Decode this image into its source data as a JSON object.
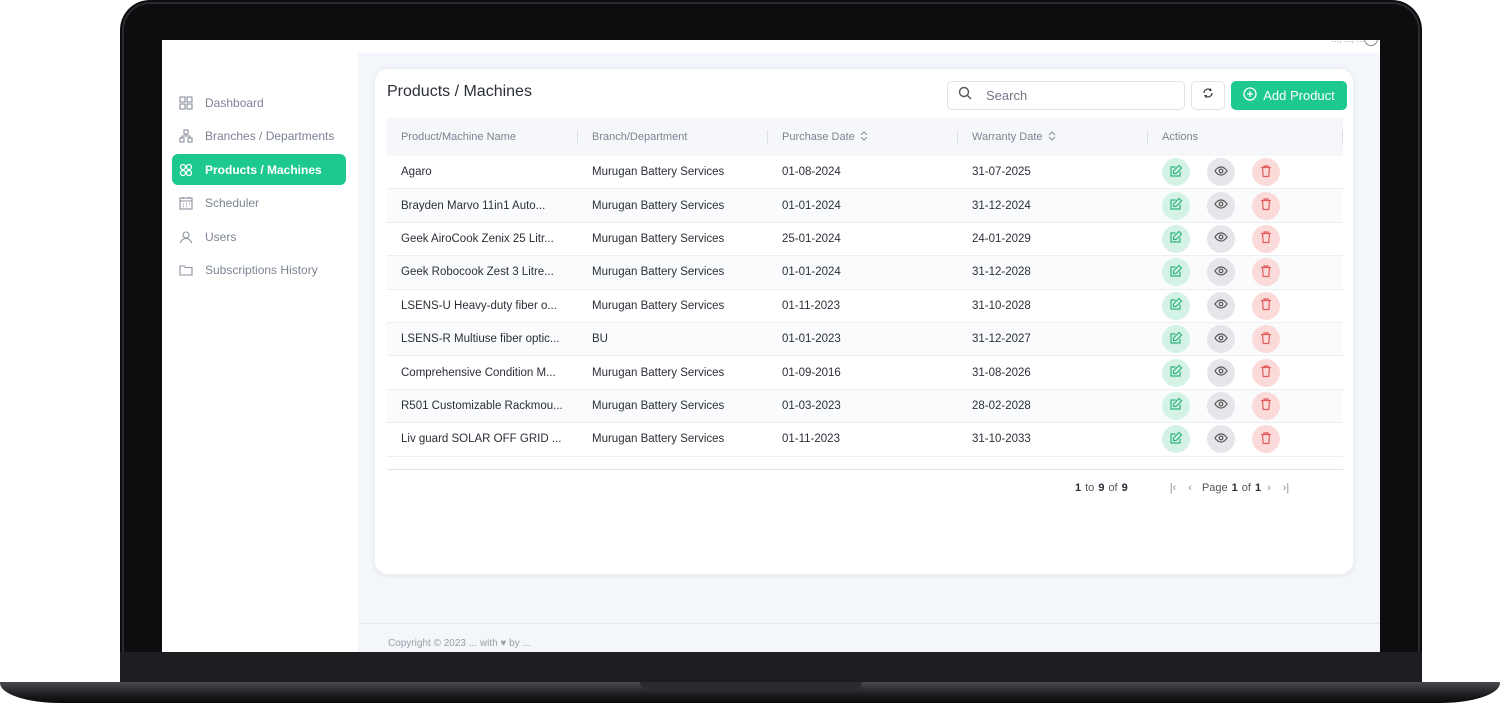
{
  "topbar": {
    "user_text": "..., ..., ...",
    "avatar_icon": "user-avatar-icon"
  },
  "sidebar": {
    "items": [
      {
        "label": "Dashboard",
        "icon": "grid-icon",
        "active": false
      },
      {
        "label": "Branches / Departments",
        "icon": "hierarchy-icon",
        "active": false
      },
      {
        "label": "Products / Machines",
        "icon": "boxes-icon",
        "active": true
      },
      {
        "label": "Scheduler",
        "icon": "calendar-icon",
        "active": false
      },
      {
        "label": "Users",
        "icon": "user-icon",
        "active": false
      },
      {
        "label": "Subscriptions History",
        "icon": "folder-icon",
        "active": false
      }
    ]
  },
  "main": {
    "title": "Products / Machines",
    "search_placeholder": "Search",
    "add_button_label": "Add Product",
    "columns": [
      "Product/Machine Name",
      "Branch/Department",
      "Purchase Date",
      "Warranty Date",
      "Actions"
    ],
    "rows": [
      [
        "Agaro",
        "Murugan Battery Services",
        "01-08-2024",
        "31-07-2025"
      ],
      [
        "Brayden Marvo 11in1 Auto...",
        "Murugan Battery Services",
        "01-01-2024",
        "31-12-2024"
      ],
      [
        "Geek AiroCook Zenix 25 Litr...",
        "Murugan Battery Services",
        "25-01-2024",
        "24-01-2029"
      ],
      [
        "Geek Robocook Zest 3 Litre...",
        "Murugan Battery Services",
        "01-01-2024",
        "31-12-2028"
      ],
      [
        "LSENS-U Heavy-duty fiber o...",
        "Murugan Battery Services",
        "01-11-2023",
        "31-10-2028"
      ],
      [
        "LSENS-R Multiuse fiber optic...",
        "BU",
        "01-01-2023",
        "31-12-2027"
      ],
      [
        "Comprehensive Condition M...",
        "Murugan Battery Services",
        "01-09-2016",
        "31-08-2026"
      ],
      [
        "R501 Customizable Rackmou...",
        "Murugan Battery Services",
        "01-03-2023",
        "28-02-2028"
      ],
      [
        "Liv guard SOLAR OFF GRID ...",
        "Murugan Battery Services",
        "01-11-2023",
        "31-10-2033"
      ]
    ],
    "pagination": {
      "from": "1",
      "to_word": "to",
      "to": "9",
      "of_word": "of",
      "total": "9",
      "page_word": "Page",
      "page": "1",
      "page_of_word": "of",
      "pages": "1"
    }
  },
  "footer": {
    "text": "Copyright © 2023 ... with ♥ by ..."
  },
  "colors": {
    "accent": "#1ec98e",
    "edit_bg": "#d4f3e6",
    "view_bg": "#e4e6ea",
    "delete_bg": "#fbdada",
    "delete_fg": "#e25c5c"
  }
}
